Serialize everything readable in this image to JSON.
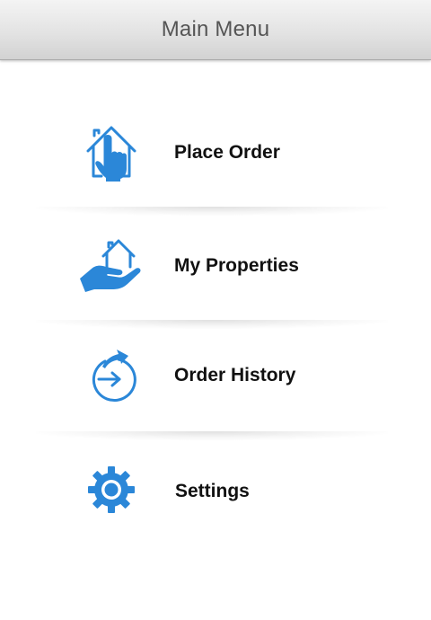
{
  "header": {
    "title": "Main Menu"
  },
  "menu": {
    "items": [
      {
        "label": "Place Order",
        "icon": "house-hand-icon"
      },
      {
        "label": "My Properties",
        "icon": "hand-house-icon"
      },
      {
        "label": "Order History",
        "icon": "history-arrow-icon"
      },
      {
        "label": "Settings",
        "icon": "gear-icon"
      }
    ]
  },
  "colors": {
    "accent": "#2b87d8",
    "header_bg": "#e3e3e3",
    "header_text": "#555555",
    "label_text": "#111111"
  }
}
